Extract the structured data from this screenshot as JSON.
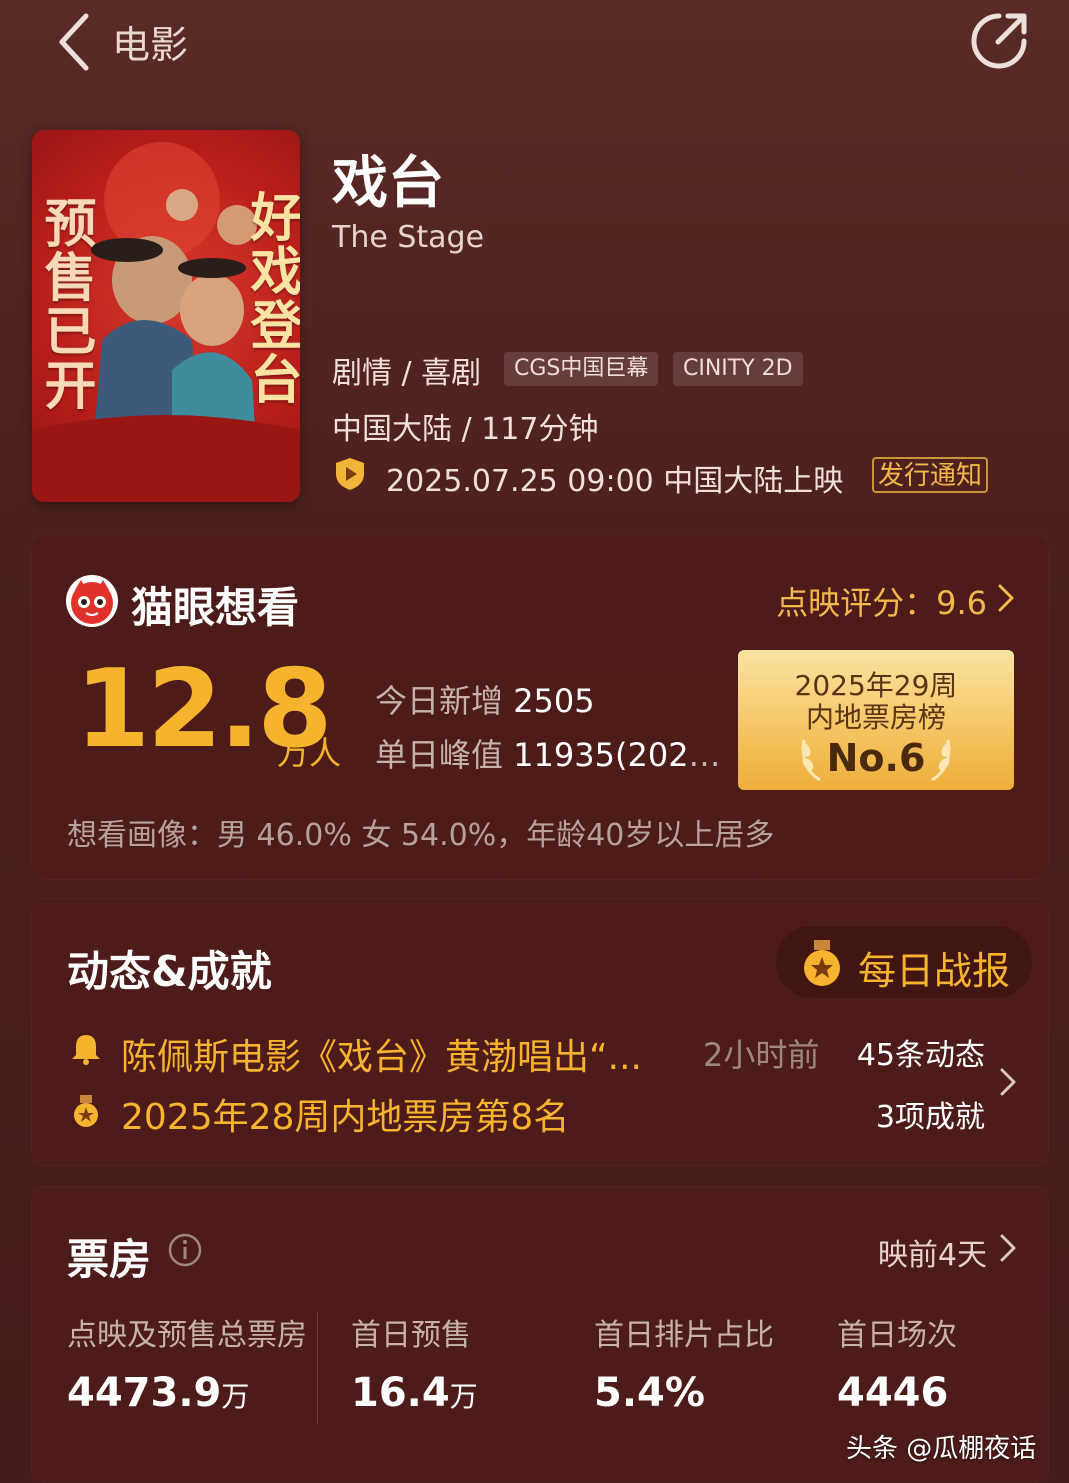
{
  "topbar": {
    "title": "电影"
  },
  "poster": {
    "left_text": "预售已开",
    "right_text": "好戏登台"
  },
  "movie": {
    "title": "戏台",
    "english_title": "The Stage",
    "genre": "剧情 / 喜剧",
    "tags": [
      "CGS中国巨幕",
      "CINITY 2D"
    ],
    "region_duration": "中国大陆 / 117分钟",
    "release": "2025.07.25 09:00 中国大陆上映",
    "notify_label": "发行通知"
  },
  "want": {
    "title": "猫眼想看",
    "rating_label": "点映评分：9.6",
    "count": "12.8",
    "count_unit": "万人",
    "today_label": "今日新增",
    "today_value": "2505",
    "peak_label": "单日峰值",
    "peak_value": "11935(2025....",
    "rank": {
      "line1": "2025年29周",
      "line2": "内地票房榜",
      "no": "No.6"
    },
    "portrait": "想看画像：男 46.0%  女 54.0%，年龄40岁以上居多"
  },
  "news": {
    "title": "动态&成就",
    "daily_label": "每日战报",
    "item1": "陈佩斯电影《戏台》黄渤唱出“...",
    "item1_time": "2小时前",
    "item1_count": "45条动态",
    "item2": "2025年28周内地票房第8名",
    "item2_count": "3项成就"
  },
  "box": {
    "title": "票房",
    "presale_days": "映前4天",
    "metrics": [
      {
        "label": "点映及预售总票房",
        "value": "4473.9",
        "unit": "万"
      },
      {
        "label": "首日预售",
        "value": "16.4",
        "unit": "万"
      },
      {
        "label": "首日排片占比",
        "value": "5.4%",
        "unit": ""
      },
      {
        "label": "首日场次",
        "value": "4446",
        "unit": ""
      }
    ]
  },
  "watermark": "头条 @瓜棚夜话",
  "colors": {
    "accent": "#f6b32e",
    "background": "#4d201e",
    "card": "#4e1c19"
  }
}
